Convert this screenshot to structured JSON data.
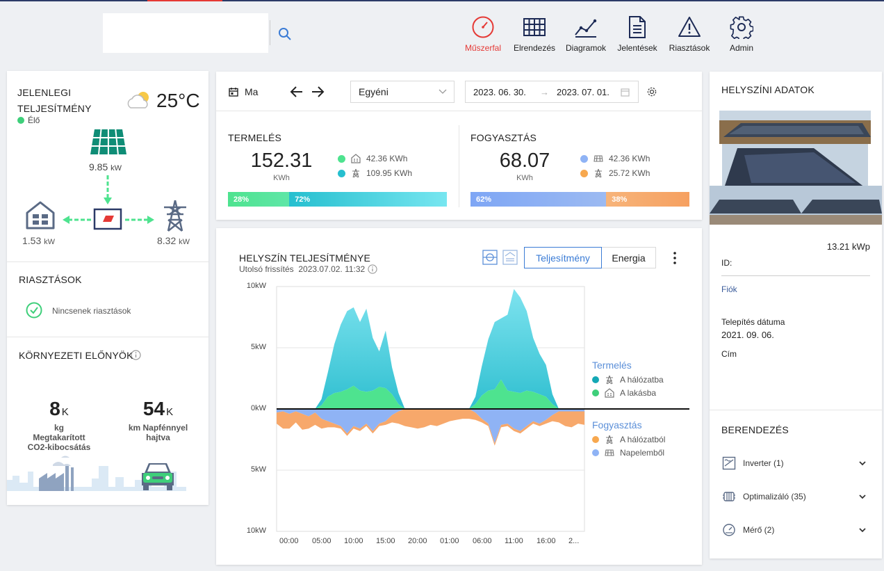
{
  "nav": {
    "items": [
      {
        "label": "Műszerfal",
        "icon": "gauge-icon"
      },
      {
        "label": "Elrendezés",
        "icon": "grid-icon"
      },
      {
        "label": "Diagramok",
        "icon": "line-chart-icon"
      },
      {
        "label": "Jelentések",
        "icon": "document-icon"
      },
      {
        "label": "Riasztások",
        "icon": "warning-icon"
      },
      {
        "label": "Admin",
        "icon": "gear-icon"
      }
    ],
    "active": "Műszerfal",
    "accent": "#e53935"
  },
  "current": {
    "title_line1": "JELENLEGI",
    "title_line2": "TELJESÍTMÉNY",
    "live": "Élő",
    "temperature": "25°C",
    "solar_value": "9.85",
    "solar_unit": "kW",
    "home_value": "1.53",
    "home_unit": "kW",
    "grid_value": "8.32",
    "grid_unit": "kW"
  },
  "alerts": {
    "title": "RIASZTÁSOK",
    "status": "Nincsenek riasztások"
  },
  "env": {
    "title": "KÖRNYEZETI ELŐNYÖK",
    "co2_value": "8",
    "co2_suffix": "K",
    "co2_label1": "kg",
    "co2_label2": "Megtakarított",
    "co2_label3": "CO2-kibocsátás",
    "km_value": "54",
    "km_suffix": "K",
    "km_label1": "km Napfénnyel",
    "km_label2": "hajtva"
  },
  "toolbar": {
    "period": "Ma",
    "select_value": "Egyéni",
    "date_from": "2023. 06. 30.",
    "date_to": "2023. 07. 01."
  },
  "production": {
    "title": "TERMELÉS",
    "total": "152.31",
    "unit": "KWh",
    "home_value": "42.36 KWh",
    "grid_value": "109.95 KWh",
    "home_pct_label": "28%",
    "grid_pct_label": "72%",
    "home_pct": 28,
    "grid_pct": 72
  },
  "consumption": {
    "title": "FOGYASZTÁS",
    "total": "68.07",
    "unit": "KWh",
    "solar_value": "42.36 KWh",
    "grid_value": "25.72 KWh",
    "solar_pct_label": "62%",
    "grid_pct_label": "38%",
    "solar_pct": 62,
    "grid_pct": 38
  },
  "site_chart": {
    "title": "HELYSZÍN TELJESÍTMÉNYE",
    "updated_label": "Utolsó frissítés",
    "updated_value": "2023.07.02. 11:32",
    "tab_power": "Teljesítmény",
    "tab_energy": "Energia",
    "legend_prod_title": "Termelés",
    "legend_to_grid": "A hálózatba",
    "legend_to_home": "A lakásba",
    "legend_cons_title": "Fogyasztás",
    "legend_from_grid": "A hálózatból",
    "legend_from_solar": "Napelemből"
  },
  "chart_data": {
    "type": "area",
    "y_ticks": [
      "10kW",
      "5kW",
      "0kW",
      "5kW",
      "10kW"
    ],
    "ylim": [
      -10,
      10
    ],
    "x_ticks": [
      "00:00",
      "05:00",
      "10:00",
      "15:00",
      "20:00",
      "01:00",
      "06:00",
      "11:00",
      "16:00",
      "2..."
    ],
    "x": [
      0,
      1,
      2,
      3,
      4,
      5,
      6,
      7,
      8,
      9,
      10,
      11,
      12,
      13,
      14,
      15,
      16,
      17,
      18,
      19,
      20,
      21,
      22,
      23,
      24,
      25,
      26,
      27,
      28,
      29,
      30,
      31,
      32,
      33,
      34,
      35,
      36,
      37,
      38,
      39,
      40,
      41,
      42,
      43,
      44,
      45,
      46,
      47,
      48
    ],
    "series": [
      {
        "name": "A lakásba",
        "color": "#4ee38f",
        "values": [
          0,
          0,
          0,
          0,
          0,
          0,
          0,
          0.3,
          1.0,
          1.3,
          1.4,
          1.6,
          1.9,
          1.5,
          1.4,
          1.5,
          1.8,
          1.7,
          1.2,
          0.4,
          0,
          0,
          0,
          0,
          0,
          0,
          0,
          0,
          0,
          0,
          0,
          0.4,
          1.1,
          1.5,
          1.6,
          2.4,
          1.5,
          1.4,
          1.3,
          1.5,
          1.4,
          1.2,
          1.0,
          0.4,
          0,
          0,
          0,
          0,
          0
        ]
      },
      {
        "name": "A hálózatba",
        "color": "#2fbfd0",
        "values": [
          0,
          0,
          0,
          0,
          0,
          0,
          0,
          0.5,
          2.0,
          4.0,
          5.5,
          6.4,
          6.4,
          5.6,
          6.8,
          4.3,
          2.9,
          4.7,
          2.2,
          0.9,
          0,
          0,
          0,
          0,
          0,
          0,
          0,
          0,
          0,
          0,
          0,
          0.6,
          2.4,
          4.2,
          5.5,
          5.0,
          6.2,
          8.4,
          7.8,
          6.5,
          4.4,
          3.3,
          2.6,
          0.8,
          0,
          0,
          0,
          0,
          0
        ]
      },
      {
        "name": "Napelemből",
        "color": "#8fb3f5",
        "values": [
          -0.3,
          -0.2,
          -0.4,
          -0.2,
          -0.4,
          -0.6,
          -0.3,
          -0.8,
          -1.0,
          -1.2,
          -1.4,
          -2.0,
          -1.4,
          -1.6,
          -1.2,
          -1.8,
          -1.2,
          -1.0,
          -0.5,
          -0.2,
          0,
          0,
          0,
          0,
          0,
          0,
          0,
          0,
          0,
          0,
          0,
          -0.3,
          -0.8,
          -1.2,
          -2.8,
          -1.3,
          -1.2,
          -1.6,
          -1.8,
          -1.4,
          -1.0,
          -1.2,
          -0.9,
          -0.5,
          -0.2,
          -0.2,
          -0.2,
          -0.2,
          -0.2
        ]
      },
      {
        "name": "A hálózatból",
        "color": "#f7a86b",
        "values": [
          -0.9,
          -1.4,
          -1.2,
          -0.9,
          -1.3,
          -1.0,
          -1.0,
          -0.8,
          -0.5,
          -0.3,
          -0.2,
          -0.2,
          -0.2,
          -0.2,
          -0.2,
          -0.2,
          -0.2,
          -0.3,
          -0.6,
          -1.0,
          -1.4,
          -1.5,
          -1.6,
          -1.5,
          -1.3,
          -1.4,
          -1.2,
          -1.0,
          -0.9,
          -0.8,
          -0.8,
          -0.6,
          -0.3,
          -0.2,
          -0.2,
          -0.2,
          -0.2,
          -0.2,
          -0.2,
          -0.2,
          -0.2,
          -0.2,
          -0.3,
          -0.5,
          -0.9,
          -1.2,
          -1.3,
          -1.0,
          -1.1
        ]
      }
    ]
  },
  "site_info": {
    "title": "HELYSZÍNI ADATOK",
    "capacity": "13.21 kWp",
    "id_label": "ID:",
    "account_label": "Fiók",
    "install_label": "Telepítés dátuma",
    "install_value": "2021. 09. 06.",
    "address_label": "Cím"
  },
  "equipment": {
    "title": "BERENDEZÉS",
    "items": [
      {
        "label": "Inverter (1)"
      },
      {
        "label": "Optimalizáló (35)"
      },
      {
        "label": "Mérő (2)"
      }
    ]
  }
}
